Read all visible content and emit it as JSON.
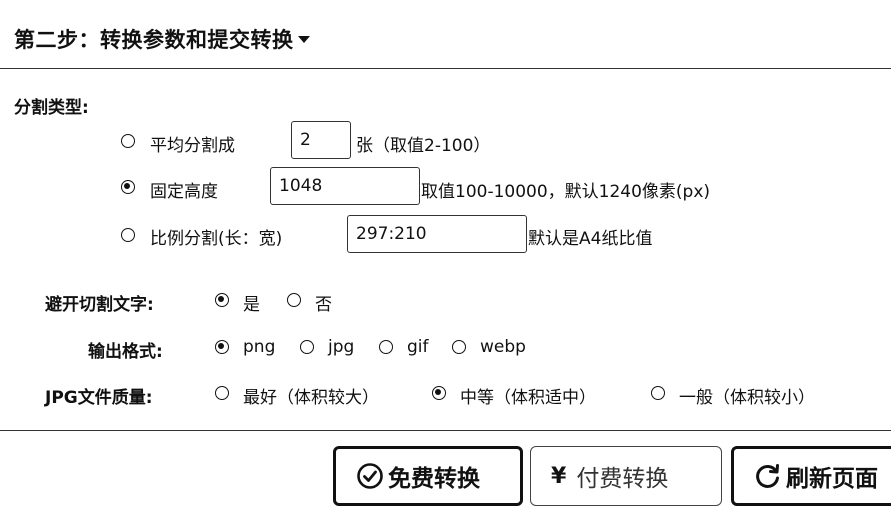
{
  "header": {
    "title": "第二步：转换参数和提交转换"
  },
  "split": {
    "section_label": "分割类型:",
    "options": [
      {
        "label": "平均分割成",
        "value": "2",
        "suffix": "张（取值2-100）",
        "selected": false
      },
      {
        "label": "固定高度",
        "value": "1048",
        "suffix": "取值100-10000，默认1240像素(px)",
        "selected": true
      },
      {
        "label": "比例分割(长：宽)",
        "value": "297:210",
        "suffix": "默认是A4纸比值",
        "selected": false
      }
    ]
  },
  "avoid_text": {
    "label": "避开切割文字:",
    "options": [
      {
        "label": "是",
        "selected": true
      },
      {
        "label": "否",
        "selected": false
      }
    ]
  },
  "output_format": {
    "label": "输出格式:",
    "options": [
      {
        "label": "png",
        "selected": true
      },
      {
        "label": "jpg",
        "selected": false
      },
      {
        "label": "gif",
        "selected": false
      },
      {
        "label": "webp",
        "selected": false
      }
    ]
  },
  "jpg_quality": {
    "label": "JPG文件质量:",
    "options": [
      {
        "label": "最好（体积较大）",
        "selected": false
      },
      {
        "label": "中等（体积适中）",
        "selected": true
      },
      {
        "label": "一般（体积较小）",
        "selected": false
      }
    ]
  },
  "buttons": {
    "free_convert": "免费转换",
    "paid_convert": "付费转换",
    "refresh": "刷新页面"
  },
  "icons": {
    "free_convert": "check-circle-icon",
    "paid_convert": "yen-icon",
    "refresh": "refresh-icon",
    "header_caret": "caret-down-icon"
  }
}
